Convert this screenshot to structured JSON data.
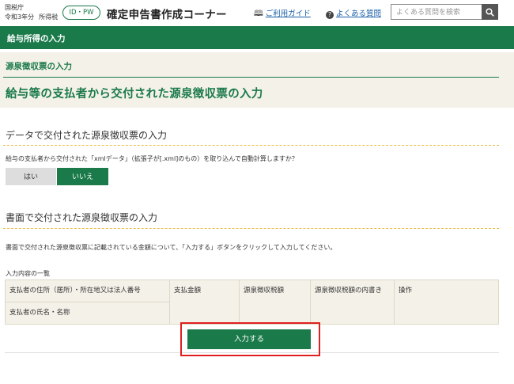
{
  "header": {
    "agency_line1": "国税庁",
    "agency_line2_year": "令和3年分",
    "agency_line2_type": "所得税",
    "idpw_badge": "ID・PW",
    "app_title": "確定申告書作成コーナー",
    "guide_link": "ご利用ガイド",
    "faq_link": "よくある質問",
    "search_placeholder": "よくある質問を検索"
  },
  "greenbar": {
    "title": "給与所得の入力"
  },
  "page": {
    "subtitle": "源泉徴収票の入力",
    "title": "給与等の支払者から交付された源泉徴収票の入力"
  },
  "data_section": {
    "heading": "データで交付された源泉徴収票の入力",
    "question": "給与の支払者から交付された「xmlデータ」（拡張子が[.xml]のもの）を取り込んで自動計算しますか？",
    "yes_label": "はい",
    "no_label": "いいえ",
    "selected": "いいえ"
  },
  "paper_section": {
    "heading": "書面で交付された源泉徴収票の入力",
    "instruction": "書面で交付された源泉徴収票に記載されている金額について、「入力する」ボタンをクリックして入力してください。"
  },
  "list": {
    "label": "入力内容の一覧",
    "columns": {
      "payer_address": "支払者の住所（居所）・所在地又は法人番号",
      "payer_name": "支払者の氏名・名称",
      "payment_amount": "支払金額",
      "withholding_tax": "源泉徴収税額",
      "withholding_breakdown": "源泉徴収税額の内書き",
      "action": "操作"
    }
  },
  "input_button": "入力する",
  "colors": {
    "brand_green": "#1a7a4a",
    "beige": "#f4f1e8",
    "highlight_red": "#e02020"
  }
}
